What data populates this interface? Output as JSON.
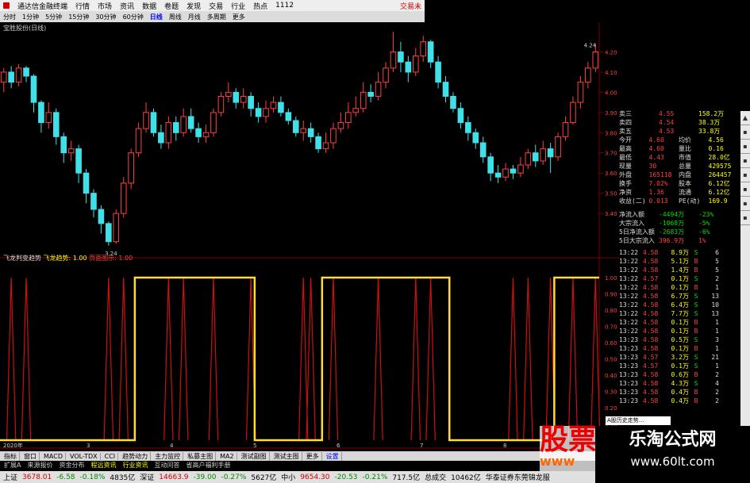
{
  "titlebar": {
    "app_name": "通达信金融终端",
    "menus": [
      "行情",
      "市场",
      "资讯",
      "数据",
      "卷题",
      "发现",
      "交易",
      "行业",
      "热点",
      "1112"
    ],
    "right_text": "交易未"
  },
  "periods": [
    "分时",
    "1分钟",
    "5分钟",
    "15分钟",
    "30分钟",
    "60分钟",
    "日线",
    "周线",
    "月线",
    "多周期",
    "更多"
  ],
  "active_period": "日线",
  "chart_title": "宝胜股份(日线)",
  "price_axis": [
    "4.20",
    "4.10",
    "4.00",
    "3.90",
    "3.80",
    "3.70",
    "3.60",
    "3.50",
    "3.40"
  ],
  "price_marks": {
    "high": "4.24",
    "low": "3.24"
  },
  "indicator_title": {
    "name": "飞龙判变趋势",
    "line1": "飞龙趋势: 1.00",
    "line2": "页面图示: 1.00"
  },
  "indicator_axis": [
    "1.00",
    "0.90",
    "0.80",
    "0.70",
    "0.60",
    "0.50",
    "0.40",
    "0.30",
    "0.20",
    "0.10"
  ],
  "x_labels": [
    "2020年",
    "3",
    "4",
    "5",
    "6",
    "7",
    "8",
    "9"
  ],
  "quote": [
    {
      "k": "卖三",
      "v": "4.55",
      "q": "158.2万"
    },
    {
      "k": "卖四",
      "v": "4.54",
      "q": "38.3万"
    },
    {
      "k": "卖五",
      "v": "4.53",
      "q": "33.8万"
    },
    {
      "k": "今开",
      "v": "4.60",
      "k2": "均价",
      "v2": "4.56"
    },
    {
      "k": "最高",
      "v": "4.60",
      "k2": "量比",
      "v2": "0.16"
    },
    {
      "k": "最低",
      "v": "4.43",
      "k2": "市值",
      "v2": "28.0亿"
    },
    {
      "k": "现量",
      "v": "30",
      "k2": "总量",
      "v2": "429575"
    },
    {
      "k": "外盘",
      "v": "165118",
      "k2": "内盘",
      "v2": "264457"
    },
    {
      "k": "换手",
      "v": "7.02%",
      "k2": "股本",
      "v2": "6.12亿"
    },
    {
      "k": "净资",
      "v": "1.36",
      "k2": "流通",
      "v2": "6.12亿"
    },
    {
      "k": "收益(二)",
      "v": "0.013",
      "k2": "PE(动)",
      "v2": "169.9"
    }
  ],
  "flows": [
    {
      "k": "净流入额",
      "v": "-4494万",
      "p": "-23%"
    },
    {
      "k": "大宗流入",
      "v": "-1068万",
      "p": "-5%"
    },
    {
      "k": "5日净流入额",
      "v": "-2683万",
      "p": "-6%"
    },
    {
      "k": "5日大宗流入",
      "v": "396.9万",
      "p": "1%"
    }
  ],
  "ticks": [
    {
      "t": "13:22",
      "p": "4.58",
      "v": "8.9万",
      "s": "S",
      "n": "6"
    },
    {
      "t": "13:22",
      "p": "4.58",
      "v": "5.1万",
      "s": "B",
      "n": "5"
    },
    {
      "t": "13:22",
      "p": "4.58",
      "v": "1.4万",
      "s": "B",
      "n": "5"
    },
    {
      "t": "13:22",
      "p": "4.57",
      "v": "0.1万",
      "s": "S",
      "n": "2"
    },
    {
      "t": "13:22",
      "p": "4.58",
      "v": "0.1万",
      "s": "B",
      "n": "1"
    },
    {
      "t": "13:22",
      "p": "4.58",
      "v": "6.7万",
      "s": "S",
      "n": "13"
    },
    {
      "t": "13:22",
      "p": "4.58",
      "v": "6.4万",
      "s": "S",
      "n": "10"
    },
    {
      "t": "13:22",
      "p": "4.58",
      "v": "7.7万",
      "s": "S",
      "n": "13"
    },
    {
      "t": "13:22",
      "p": "4.58",
      "v": "0.1万",
      "s": "B",
      "n": "1"
    },
    {
      "t": "13:22",
      "p": "4.58",
      "v": "0.1万",
      "s": "B",
      "n": "1"
    },
    {
      "t": "13:23",
      "p": "4.58",
      "v": "0.5万",
      "s": "S",
      "n": "3"
    },
    {
      "t": "13:23",
      "p": "4.58",
      "v": "0.1万",
      "s": "B",
      "n": "1"
    },
    {
      "t": "13:23",
      "p": "4.57",
      "v": "3.2万",
      "s": "S",
      "n": "21"
    },
    {
      "t": "13:23",
      "p": "4.57",
      "v": "0.1万",
      "s": "S",
      "n": "1"
    },
    {
      "t": "13:23",
      "p": "4.58",
      "v": "0.6万",
      "s": "B",
      "n": "2"
    },
    {
      "t": "13:23",
      "p": "4.58",
      "v": "4.3万",
      "s": "S",
      "n": "4"
    },
    {
      "t": "13:23",
      "p": "4.58",
      "v": "0.4万",
      "s": "B",
      "n": "2"
    },
    {
      "t": "13:23",
      "p": "4.58",
      "v": "0.4万",
      "s": "B",
      "n": "2"
    }
  ],
  "tooltip": "A股历史走势...",
  "indicator_tabs": [
    "指标",
    "窗口",
    "MACD",
    "VOL-TDX",
    "CCI",
    "趋势动力",
    "主力监控",
    "私募主图",
    "MA2",
    "测试副图",
    "测试主图",
    "更多",
    "设置"
  ],
  "indicator_tabs2": [
    "扩展A",
    "来源报价",
    "资金分布",
    "程远资讯",
    "行业资讯",
    "互动问答",
    "省高户福利手册"
  ],
  "status": {
    "sh_label": "上证",
    "sh_val": "3678.01",
    "sh_chg": "-6.58",
    "sh_pct": "-0.18%",
    "sh_amt": "4835亿",
    "sz_label": "深证",
    "sz_val": "14663.9",
    "sz_chg": "-39.00",
    "sz_pct": "-0.27%",
    "sz_amt": "5627亿",
    "zx_label": "中小",
    "zx_val": "9654.30",
    "zx_chg": "-20.53",
    "zx_pct": "-0.21%",
    "zx_amt": "717.5亿",
    "total_label": "总成交",
    "total": "10462亿",
    "broker": "华泰证券东莞锦龙服"
  },
  "watermark": {
    "stock": "股票",
    "www": "www",
    "site_cn": "乐淘公式网",
    "site_url": "www.60lt.com"
  },
  "colors": {
    "up": "#ff4040",
    "down": "#40e0e8",
    "trend": "#ffdd33",
    "signal": "#cc1010"
  },
  "chart_data": {
    "type": "candlestick",
    "y_range": [
      3.2,
      4.3
    ],
    "candles": [
      [
        4.05,
        4.1,
        4.12,
        4.0
      ],
      [
        4.1,
        4.05,
        4.13,
        4.02
      ],
      [
        4.05,
        4.12,
        4.14,
        4.03
      ],
      [
        4.12,
        4.08,
        4.13,
        4.05
      ],
      [
        4.08,
        3.95,
        4.09,
        3.9
      ],
      [
        3.95,
        3.85,
        3.96,
        3.8
      ],
      [
        3.85,
        3.9,
        3.95,
        3.82
      ],
      [
        3.9,
        3.78,
        3.92,
        3.74
      ],
      [
        3.78,
        3.7,
        3.8,
        3.65
      ],
      [
        3.7,
        3.72,
        3.76,
        3.66
      ],
      [
        3.72,
        3.6,
        3.74,
        3.55
      ],
      [
        3.6,
        3.5,
        3.62,
        3.45
      ],
      [
        3.5,
        3.42,
        3.52,
        3.38
      ],
      [
        3.42,
        3.35,
        3.44,
        3.3
      ],
      [
        3.35,
        3.26,
        3.36,
        3.24
      ],
      [
        3.26,
        3.4,
        3.42,
        3.25
      ],
      [
        3.4,
        3.55,
        3.58,
        3.38
      ],
      [
        3.55,
        3.7,
        3.72,
        3.52
      ],
      [
        3.7,
        3.82,
        3.85,
        3.68
      ],
      [
        3.82,
        3.9,
        3.95,
        3.8
      ],
      [
        3.9,
        3.8,
        3.92,
        3.78
      ],
      [
        3.8,
        3.75,
        3.84,
        3.72
      ],
      [
        3.75,
        3.85,
        3.88,
        3.72
      ],
      [
        3.85,
        3.8,
        3.88,
        3.76
      ],
      [
        3.8,
        3.88,
        3.92,
        3.78
      ],
      [
        3.88,
        3.82,
        3.92,
        3.8
      ],
      [
        3.82,
        3.78,
        3.85,
        3.75
      ],
      [
        3.78,
        3.8,
        3.84,
        3.75
      ],
      [
        3.8,
        3.9,
        3.92,
        3.78
      ],
      [
        3.9,
        3.98,
        4.0,
        3.88
      ],
      [
        3.98,
        4.0,
        4.05,
        3.95
      ],
      [
        4.0,
        3.95,
        4.02,
        3.92
      ],
      [
        3.95,
        3.98,
        4.02,
        3.92
      ],
      [
        3.98,
        3.92,
        4.0,
        3.88
      ],
      [
        3.92,
        3.88,
        3.95,
        3.85
      ],
      [
        3.88,
        3.92,
        3.96,
        3.85
      ],
      [
        3.92,
        3.95,
        3.98,
        3.9
      ],
      [
        3.95,
        3.9,
        3.98,
        3.88
      ],
      [
        3.9,
        3.86,
        3.92,
        3.84
      ],
      [
        3.86,
        3.8,
        3.88,
        3.78
      ],
      [
        3.8,
        3.82,
        3.86,
        3.76
      ],
      [
        3.82,
        3.78,
        3.85,
        3.75
      ],
      [
        3.78,
        3.72,
        3.8,
        3.7
      ],
      [
        3.72,
        3.75,
        3.8,
        3.7
      ],
      [
        3.75,
        3.82,
        3.85,
        3.72
      ],
      [
        3.82,
        3.85,
        3.9,
        3.8
      ],
      [
        3.85,
        3.9,
        3.95,
        3.82
      ],
      [
        3.9,
        3.92,
        3.98,
        3.88
      ],
      [
        3.92,
        4.0,
        4.05,
        3.9
      ],
      [
        4.0,
        3.98,
        4.04,
        3.95
      ],
      [
        3.98,
        4.05,
        4.1,
        3.96
      ],
      [
        4.05,
        4.12,
        4.15,
        4.02
      ],
      [
        4.12,
        4.2,
        4.3,
        4.1
      ],
      [
        4.2,
        4.15,
        4.25,
        4.1
      ],
      [
        4.15,
        4.1,
        4.18,
        4.05
      ],
      [
        4.1,
        4.18,
        4.22,
        4.08
      ],
      [
        4.18,
        4.25,
        4.28,
        4.15
      ],
      [
        4.25,
        4.15,
        4.26,
        4.12
      ],
      [
        4.15,
        4.05,
        4.18,
        4.02
      ],
      [
        4.05,
        3.98,
        4.08,
        3.95
      ],
      [
        3.98,
        3.92,
        4.0,
        3.9
      ],
      [
        3.92,
        3.85,
        3.95,
        3.82
      ],
      [
        3.85,
        3.8,
        3.88,
        3.76
      ],
      [
        3.8,
        3.75,
        3.82,
        3.72
      ],
      [
        3.75,
        3.68,
        3.78,
        3.65
      ],
      [
        3.68,
        3.6,
        3.7,
        3.56
      ],
      [
        3.6,
        3.58,
        3.64,
        3.55
      ],
      [
        3.58,
        3.62,
        3.65,
        3.56
      ],
      [
        3.62,
        3.6,
        3.64,
        3.57
      ],
      [
        3.6,
        3.64,
        3.68,
        3.58
      ],
      [
        3.64,
        3.7,
        3.72,
        3.62
      ],
      [
        3.7,
        3.66,
        3.74,
        3.63
      ],
      [
        3.66,
        3.72,
        3.76,
        3.64
      ],
      [
        3.72,
        3.68,
        3.75,
        3.6
      ],
      [
        3.68,
        3.78,
        3.8,
        3.66
      ],
      [
        3.78,
        3.85,
        3.88,
        3.76
      ],
      [
        3.85,
        3.95,
        3.98,
        3.84
      ],
      [
        3.95,
        4.05,
        4.08,
        3.92
      ],
      [
        4.05,
        4.12,
        4.15,
        4.02
      ],
      [
        4.12,
        4.2,
        4.24,
        4.1
      ]
    ],
    "trend": [
      0,
      0,
      0,
      0,
      0,
      0,
      0,
      0,
      0,
      0,
      0,
      0,
      0,
      0,
      0,
      0,
      0,
      0,
      1,
      1,
      1,
      1,
      1,
      1,
      1,
      1,
      1,
      1,
      1,
      1,
      1,
      1,
      1,
      1,
      0,
      0,
      0,
      0,
      0,
      0,
      0,
      0,
      0,
      1,
      1,
      1,
      1,
      1,
      1,
      1,
      1,
      1,
      1,
      1,
      1,
      1,
      1,
      1,
      1,
      1,
      0,
      0,
      0,
      0,
      0,
      0,
      0,
      0,
      0,
      0,
      0,
      0,
      0,
      0,
      1,
      1,
      1,
      1,
      1,
      1
    ],
    "signal_spikes": [
      1,
      3,
      14,
      16,
      22,
      24,
      28,
      33,
      40,
      41,
      44,
      50,
      55,
      57,
      68,
      70,
      73,
      76,
      79
    ]
  }
}
